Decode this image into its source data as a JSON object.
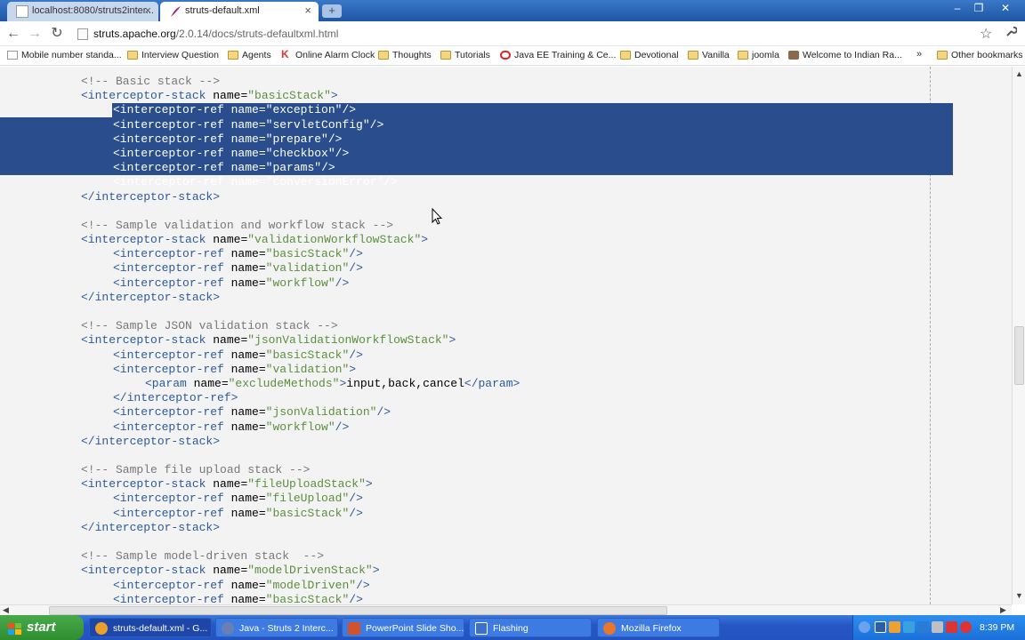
{
  "tabs": [
    {
      "title": "localhost:8080/struts2inter...",
      "active": false
    },
    {
      "title": "struts-default.xml",
      "active": true
    }
  ],
  "newtab_label": "+",
  "window_controls": {
    "minimize": "–",
    "maximize": "❐",
    "close": "✕"
  },
  "toolbar": {
    "back": "←",
    "forward": "→",
    "reload": "↻",
    "url_host": "struts.apache.org",
    "url_path": "/2.0.14/docs/struts-defaultxml.html",
    "star": "☆",
    "wrench": "🔧"
  },
  "bookmarks": [
    {
      "label": "Mobile number standa...",
      "icon": "page-icon"
    },
    {
      "label": "Interview Question",
      "icon": "folder-icon"
    },
    {
      "label": "Agents",
      "icon": "folder-icon"
    },
    {
      "label": "Online Alarm Clock",
      "icon": "k-icon"
    },
    {
      "label": "Thoughts",
      "icon": "folder-icon"
    },
    {
      "label": "Tutorials",
      "icon": "folder-icon"
    },
    {
      "label": "Java EE Training & Ce...",
      "icon": "oracle-icon"
    },
    {
      "label": "Devotional",
      "icon": "folder-icon"
    },
    {
      "label": "Vanilla",
      "icon": "folder-icon"
    },
    {
      "label": "joomla",
      "icon": "folder-icon"
    },
    {
      "label": "Welcome to Indian Ra...",
      "icon": "train-icon"
    }
  ],
  "bookmarks_more": "»",
  "other_bookmarks": "Other bookmarks",
  "code_lines": [
    "<!-- Basic stack -->",
    "<interceptor-stack name=\"basicStack\">",
    "<interceptor-ref name=\"exception\"/>",
    "<interceptor-ref name=\"servletConfig\"/>",
    "<interceptor-ref name=\"prepare\"/>",
    "<interceptor-ref name=\"checkbox\"/>",
    "<interceptor-ref name=\"params\"/>",
    "<interceptor-ref name=\"conversionError\"/>",
    "</interceptor-stack>",
    "",
    "<!-- Sample validation and workflow stack -->",
    "<interceptor-stack name=\"validationWorkflowStack\">",
    "<interceptor-ref name=\"basicStack\"/>",
    "<interceptor-ref name=\"validation\"/>",
    "<interceptor-ref name=\"workflow\"/>",
    "</interceptor-stack>",
    "",
    "<!-- Sample JSON validation stack -->",
    "<interceptor-stack name=\"jsonValidationWorkflowStack\">",
    "<interceptor-ref name=\"basicStack\"/>",
    "<interceptor-ref name=\"validation\">",
    "<param name=\"excludeMethods\">input,back,cancel</param>",
    "</interceptor-ref>",
    "<interceptor-ref name=\"jsonValidation\"/>",
    "<interceptor-ref name=\"workflow\"/>",
    "</interceptor-stack>",
    "",
    "<!-- Sample file upload stack -->",
    "<interceptor-stack name=\"fileUploadStack\">",
    "<interceptor-ref name=\"fileUpload\"/>",
    "<interceptor-ref name=\"basicStack\"/>",
    "</interceptor-stack>",
    "",
    "<!-- Sample model-driven stack  -->",
    "<interceptor-stack name=\"modelDrivenStack\">",
    "<interceptor-ref name=\"modelDriven\"/>",
    "<interceptor-ref name=\"basicStack\"/>"
  ],
  "taskbar": {
    "start": "start",
    "tasks": [
      {
        "label": "struts-default.xml - G...",
        "active": true,
        "color": "#e9a12b"
      },
      {
        "label": "Java - Struts 2 Interc...",
        "active": false,
        "color": "#6a7fb6"
      },
      {
        "label": "PowerPoint Slide Sho...",
        "active": false,
        "color": "#d2532b"
      },
      {
        "label": "Flashing",
        "active": false,
        "color": "#3b6fd1"
      },
      {
        "label": "Mozilla Firefox",
        "active": false,
        "color": "#e8772a"
      }
    ],
    "clock": "8:39 PM"
  }
}
